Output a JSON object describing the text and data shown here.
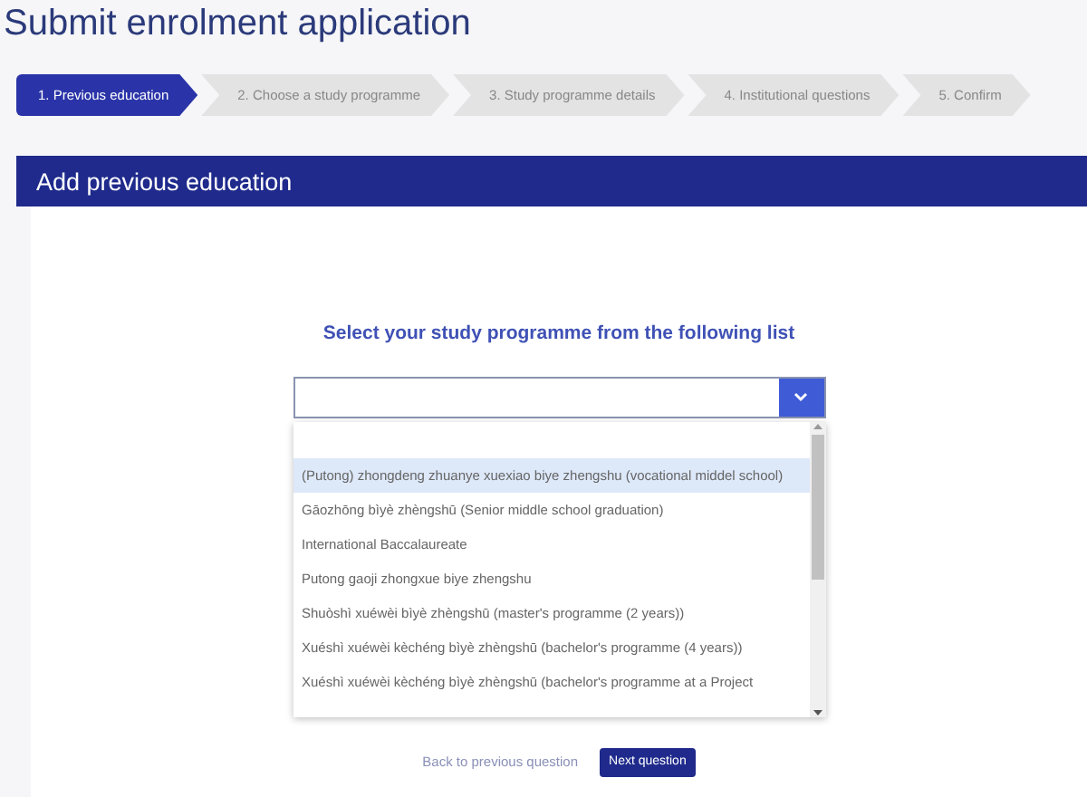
{
  "page": {
    "title": "Submit enrolment application"
  },
  "steps": [
    {
      "label": "1. Previous education",
      "selected": true
    },
    {
      "label": "2. Choose a study programme",
      "selected": false
    },
    {
      "label": "3. Study programme details",
      "selected": false
    },
    {
      "label": "4. Institutional questions",
      "selected": false
    },
    {
      "label": "5. Confirm",
      "selected": false
    }
  ],
  "panel": {
    "title": "Add previous education"
  },
  "question": {
    "heading": "Select your study programme from the following list"
  },
  "options": [
    {
      "label": "(Putong) zhongdeng zhuanye xuexiao biye zhengshu (vocational middel school)",
      "selected": true
    },
    {
      "label": "Gāozhōng bìyè zhèngshū (Senior middle school graduation)",
      "selected": false
    },
    {
      "label": "International Baccalaureate",
      "selected": false
    },
    {
      "label": "Putong gaoji zhongxue biye zhengshu",
      "selected": false
    },
    {
      "label": "Shuòshì xuéwèi bìyè zhèngshū (master's programme (2 years))",
      "selected": false
    },
    {
      "label": "Xuéshì xuéwèi kèchéng bìyè zhèngshū (bachelor's programme (4 years))",
      "selected": false
    },
    {
      "label": "Xuéshì xuéwèi kèchéng bìyè zhèngshū (bachelor's programme at a Project",
      "selected": false
    }
  ],
  "buttons": {
    "back": "Back to previous question",
    "next": "Next question"
  }
}
